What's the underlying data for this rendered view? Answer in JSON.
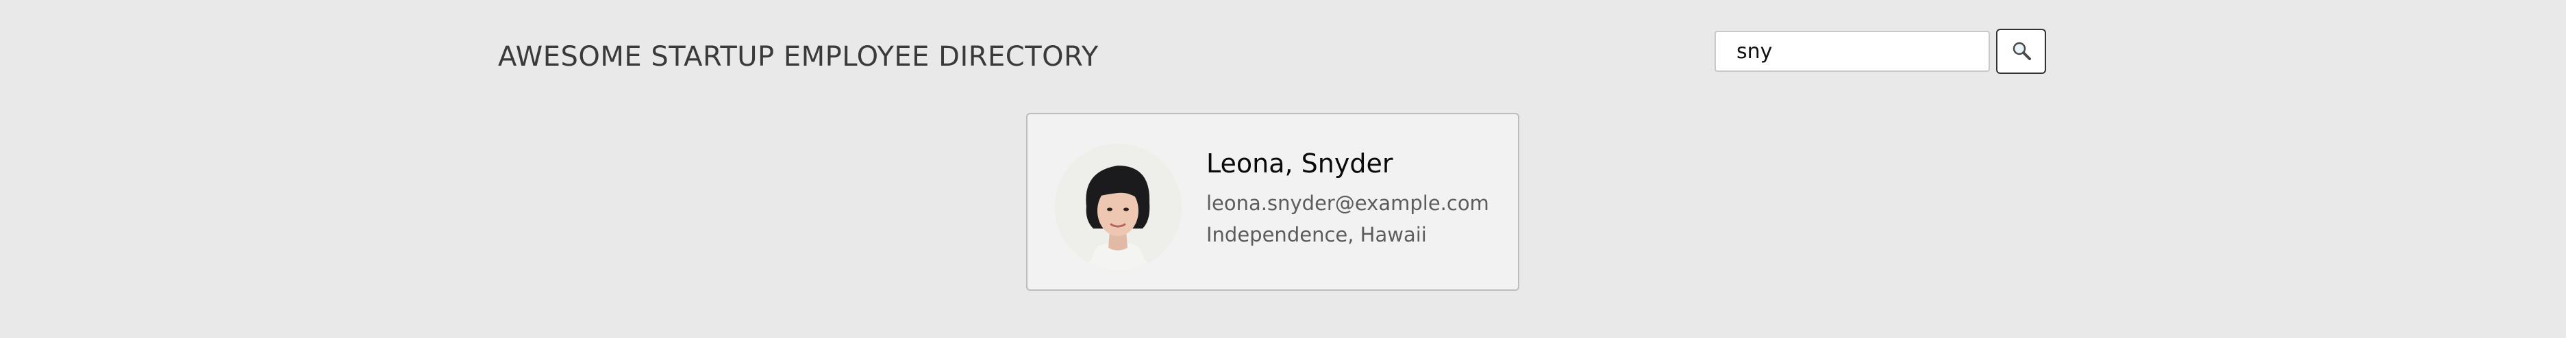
{
  "header": {
    "title": "AWESOME STARTUP EMPLOYEE DIRECTORY"
  },
  "search": {
    "value": "sny",
    "button_icon": "search-icon"
  },
  "employees": [
    {
      "name": "Leona, Snyder",
      "email": "leona.snyder@example.com",
      "location": "Independence, Hawaii",
      "avatar_icon": "avatar-photo"
    }
  ]
}
